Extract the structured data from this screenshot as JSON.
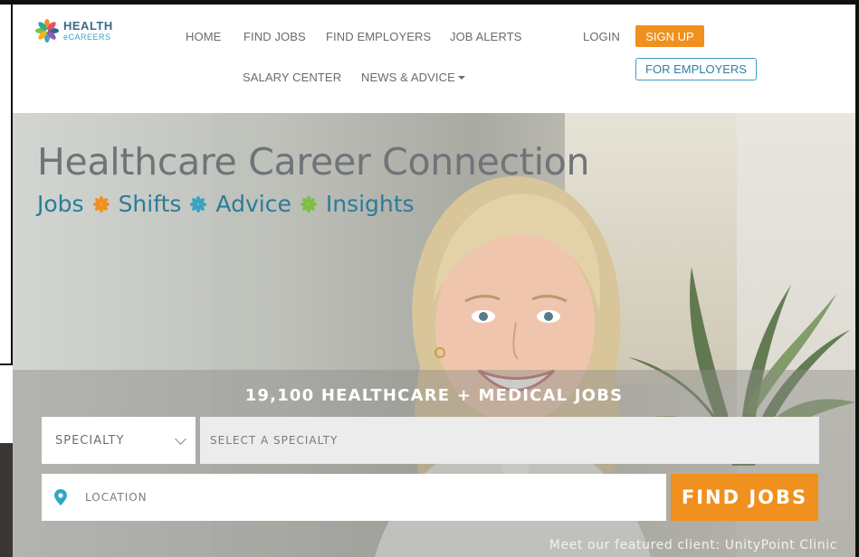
{
  "header": {
    "logo": {
      "line1": "HEALTH",
      "line2": "eCAREERS"
    },
    "nav": {
      "home": "HOME",
      "find_jobs": "FIND JOBS",
      "find_employers": "FIND EMPLOYERS",
      "job_alerts": "JOB ALERTS",
      "login": "LOGIN",
      "salary_center": "SALARY CENTER",
      "news_advice": "NEWS & ADVICE"
    },
    "signup_label": "SIGN UP",
    "for_employers_label": "FOR EMPLOYERS"
  },
  "hero": {
    "title": "Healthcare Career Connection",
    "tags": [
      "Jobs",
      "Shifts",
      "Advice",
      "Insights"
    ],
    "tag_icon_colors": [
      "#f0901e",
      "#3aa3c4",
      "#7dc142"
    ]
  },
  "search": {
    "job_count": "19,100 HEALTHCARE + MEDICAL JOBS",
    "specialty_dropdown": "SPECIALTY",
    "specialty_placeholder": "SELECT A SPECIALTY",
    "location_placeholder": "LOCATION",
    "find_button": "FIND JOBS"
  },
  "featured_text": "Meet our featured client: UnityPoint Clinic",
  "colors": {
    "accent_orange": "#f0901e",
    "accent_teal": "#2a7d97",
    "link_blue": "#2d7fa3"
  }
}
